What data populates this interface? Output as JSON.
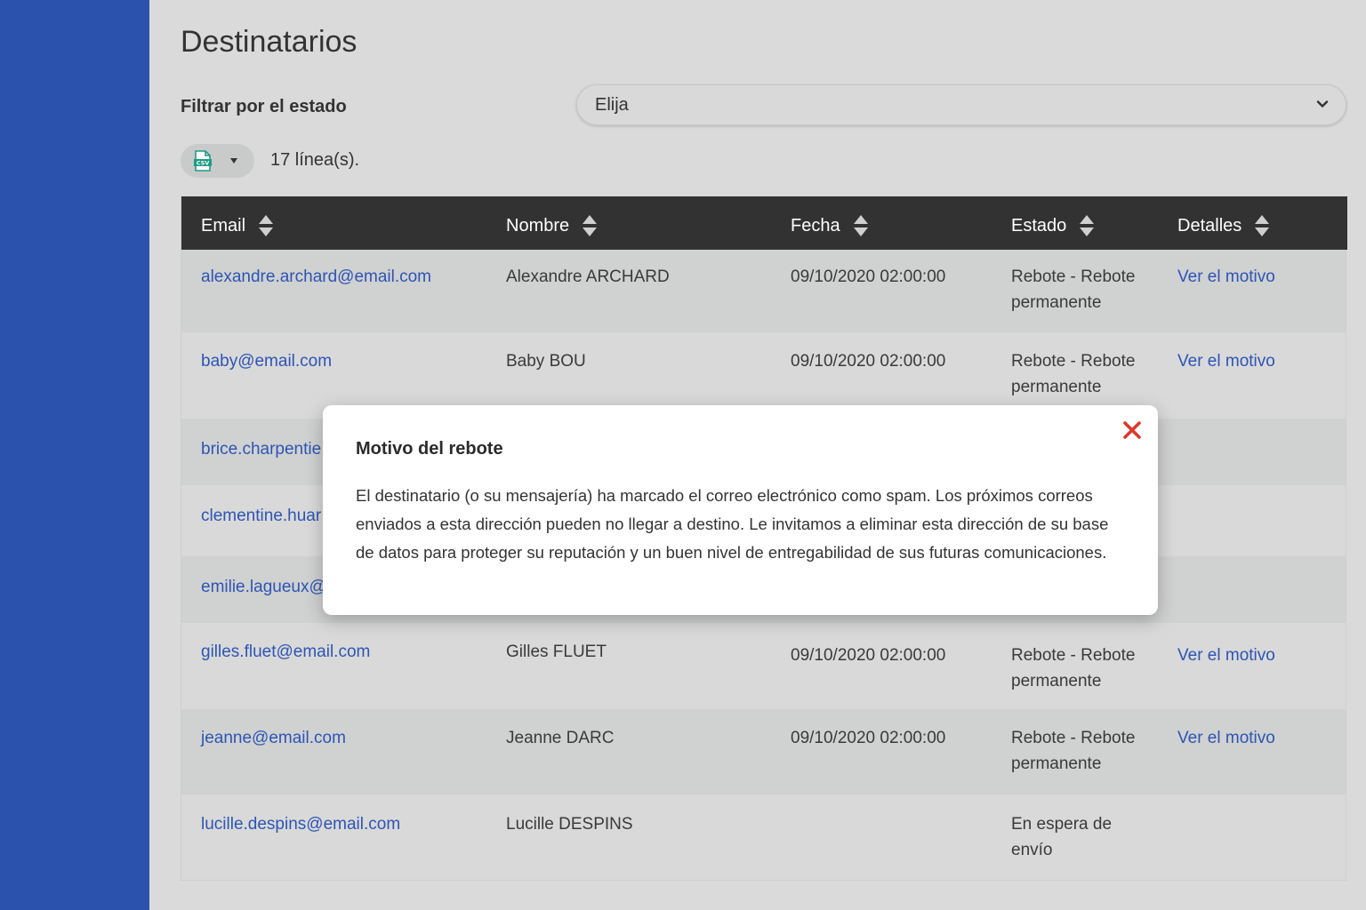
{
  "header": {
    "title": "Destinatarios"
  },
  "filter": {
    "label": "Filtrar por el estado",
    "selected": "Elija"
  },
  "toolbar": {
    "export_icon": "csv-file-icon",
    "line_count": "17 línea(s)."
  },
  "table": {
    "columns": [
      "Email",
      "Nombre",
      "Fecha",
      "Estado",
      "Detalles"
    ],
    "rows": [
      {
        "email": "alexandre.archard@email.com",
        "name": "Alexandre ARCHARD",
        "date": "09/10/2020 02:00:00",
        "state_line1": "Rebote - Rebote",
        "state_line2": "permanente",
        "details": "Ver el motivo"
      },
      {
        "email": "baby@email.com",
        "name": "Baby BOU",
        "date": "09/10/2020 02:00:00",
        "state_line1": "Rebote - Rebote",
        "state_line2": "permanente",
        "details": "Ver el motivo"
      },
      {
        "email": "brice.charpentie"
      },
      {
        "email": "clementine.huar"
      },
      {
        "email": "emilie.lagueux@"
      },
      {
        "email": "gilles.fluet@email.com",
        "name": "Gilles FLUET",
        "date": "09/10/2020 02:00:00",
        "state_line1": "Rebote - Rebote",
        "state_line2": "permanente",
        "details": "Ver el motivo"
      },
      {
        "email": "jeanne@email.com",
        "name": "Jeanne DARC",
        "date": "09/10/2020 02:00:00",
        "state_line1": "Rebote - Rebote",
        "state_line2": "permanente",
        "details": "Ver el motivo"
      },
      {
        "email": "lucille.despins@email.com",
        "name": "Lucille DESPINS",
        "state_line1": "En espera de",
        "state_line2": "envío"
      }
    ]
  },
  "modal": {
    "title": "Motivo del rebote",
    "body_line1": "El destinatario (o su mensajería) ha marcado el correo electrónico como spam. Los próximos correos",
    "body_line2": "enviados a esta dirección pueden no llegar a destino. Le invitamos a eliminar esta dirección de su base",
    "body_line3": "de datos para proteger su reputación y un buen nivel de entregabilidad de sus futuras comunicaciones."
  },
  "colors": {
    "sidebar": "#2b53ad",
    "link": "#2d55b5",
    "table_header": "#323232",
    "close": "#e0362a"
  }
}
